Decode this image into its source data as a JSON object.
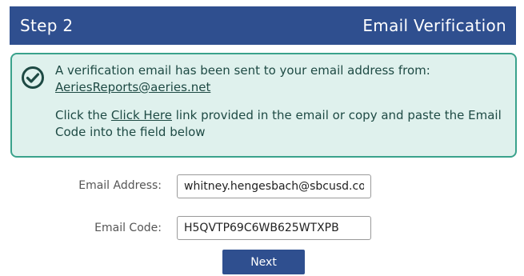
{
  "header": {
    "step": "Step 2",
    "title": "Email Verification"
  },
  "notice": {
    "icon": "check-circle-icon",
    "line1": "A verification email has been sent to your email address from:",
    "sender_email": "AeriesReports@aeries.net",
    "line2_prefix": "Click the ",
    "click_here_link": "Click Here",
    "line2_suffix": " link provided in the email or copy and paste the Email Code into the field below"
  },
  "form": {
    "email_address_label": "Email Address:",
    "email_address_value": "whitney.hengesbach@sbcusd.com",
    "email_code_label": "Email Code:",
    "email_code_value": "H5QVTP69C6WB625WTXPB"
  },
  "buttons": {
    "next_label": "Next"
  },
  "colors": {
    "header_bg": "#2f4f8f",
    "notice_bg": "#dff1ed",
    "notice_border": "#3aa28c",
    "notice_text": "#1e4a44",
    "button_bg": "#2f4f8f"
  }
}
